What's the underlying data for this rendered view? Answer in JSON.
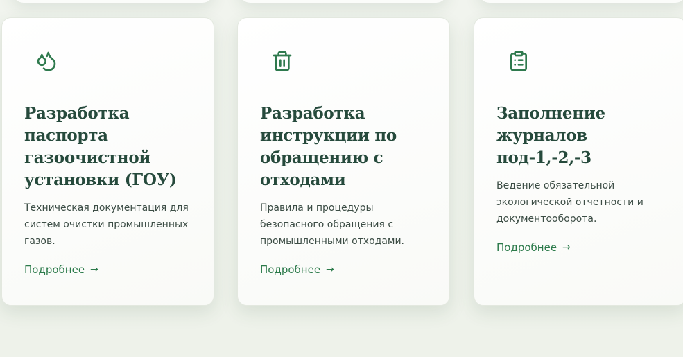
{
  "cards": [
    {
      "icon": "droplets-icon",
      "title": "Разработка паспорта газоочистной установки (ГОУ)",
      "description": "Техническая документация для систем очистки промышленных газов.",
      "link_label": "Подробнее",
      "arrow": "→"
    },
    {
      "icon": "trash-icon",
      "title": "Разработка инструкции по обращению с отходами",
      "description": "Правила и процедуры безопасного обращения с промышленными отходами.",
      "link_label": "Подробнее",
      "arrow": "→"
    },
    {
      "icon": "clipboard-list-icon",
      "title": "Заполнение журналов под-1,-2,-3",
      "description": "Ведение обязательной экологической отчетности и документооборота.",
      "link_label": "Подробнее",
      "arrow": "→"
    }
  ],
  "colors": {
    "accent": "#2f7a4e",
    "title": "#264a3c",
    "text": "#3c4d45",
    "background": "#f1f4ee"
  }
}
